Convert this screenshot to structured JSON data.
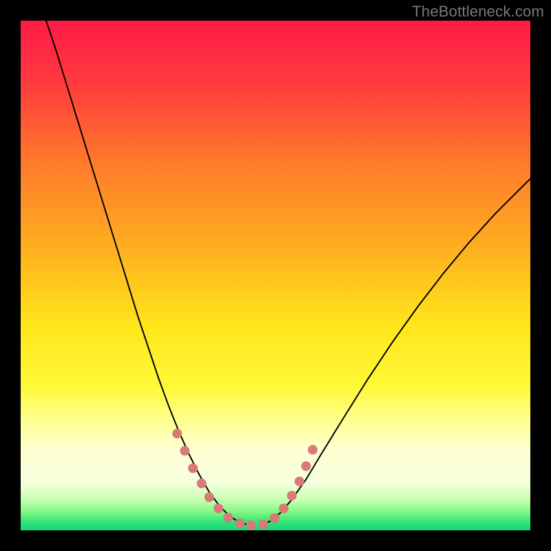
{
  "watermark": "TheBottleneck.com",
  "chart_data": {
    "type": "line",
    "title": "",
    "xlabel": "",
    "ylabel": "",
    "xlim": [
      0,
      1
    ],
    "ylim": [
      0,
      1
    ],
    "background_gradient": {
      "stops": [
        {
          "offset": 0.0,
          "color": "#ff1a45"
        },
        {
          "offset": 0.12,
          "color": "#ff3a3f"
        },
        {
          "offset": 0.28,
          "color": "#ff7a2a"
        },
        {
          "offset": 0.45,
          "color": "#ffb01f"
        },
        {
          "offset": 0.6,
          "color": "#ffe61a"
        },
        {
          "offset": 0.72,
          "color": "#fff93a"
        },
        {
          "offset": 0.78,
          "color": "#ffff8a"
        },
        {
          "offset": 0.84,
          "color": "#ffffd0"
        },
        {
          "offset": 0.905,
          "color": "#f6ffdf"
        },
        {
          "offset": 0.94,
          "color": "#c9ffb0"
        },
        {
          "offset": 0.965,
          "color": "#7cf783"
        },
        {
          "offset": 0.985,
          "color": "#2de37a"
        },
        {
          "offset": 1.0,
          "color": "#17d67a"
        }
      ]
    },
    "series": [
      {
        "name": "left-curve",
        "color": "#000000",
        "width": 2,
        "points": [
          {
            "x": 0.05,
            "y": 1.0
          },
          {
            "x": 0.07,
            "y": 0.94
          },
          {
            "x": 0.09,
            "y": 0.875
          },
          {
            "x": 0.11,
            "y": 0.81
          },
          {
            "x": 0.13,
            "y": 0.745
          },
          {
            "x": 0.15,
            "y": 0.68
          },
          {
            "x": 0.17,
            "y": 0.615
          },
          {
            "x": 0.19,
            "y": 0.55
          },
          {
            "x": 0.21,
            "y": 0.485
          },
          {
            "x": 0.23,
            "y": 0.42
          },
          {
            "x": 0.25,
            "y": 0.36
          },
          {
            "x": 0.27,
            "y": 0.3
          },
          {
            "x": 0.29,
            "y": 0.245
          },
          {
            "x": 0.31,
            "y": 0.195
          },
          {
            "x": 0.33,
            "y": 0.15
          },
          {
            "x": 0.35,
            "y": 0.11
          },
          {
            "x": 0.37,
            "y": 0.075
          },
          {
            "x": 0.39,
            "y": 0.048
          },
          {
            "x": 0.41,
            "y": 0.028
          },
          {
            "x": 0.43,
            "y": 0.015
          },
          {
            "x": 0.45,
            "y": 0.01
          }
        ]
      },
      {
        "name": "right-curve",
        "color": "#000000",
        "width": 2,
        "points": [
          {
            "x": 0.47,
            "y": 0.01
          },
          {
            "x": 0.49,
            "y": 0.018
          },
          {
            "x": 0.51,
            "y": 0.035
          },
          {
            "x": 0.53,
            "y": 0.058
          },
          {
            "x": 0.56,
            "y": 0.1
          },
          {
            "x": 0.59,
            "y": 0.15
          },
          {
            "x": 0.63,
            "y": 0.215
          },
          {
            "x": 0.68,
            "y": 0.295
          },
          {
            "x": 0.73,
            "y": 0.37
          },
          {
            "x": 0.78,
            "y": 0.44
          },
          {
            "x": 0.83,
            "y": 0.505
          },
          {
            "x": 0.88,
            "y": 0.565
          },
          {
            "x": 0.93,
            "y": 0.62
          },
          {
            "x": 0.98,
            "y": 0.67
          },
          {
            "x": 1.0,
            "y": 0.69
          }
        ]
      }
    ],
    "markers": {
      "name": "salmon-dots",
      "color": "#d97a78",
      "radius_frac": 0.0095,
      "points": [
        {
          "x": 0.307,
          "y": 0.19
        },
        {
          "x": 0.322,
          "y": 0.156
        },
        {
          "x": 0.338,
          "y": 0.122
        },
        {
          "x": 0.355,
          "y": 0.092
        },
        {
          "x": 0.37,
          "y": 0.065
        },
        {
          "x": 0.388,
          "y": 0.043
        },
        {
          "x": 0.407,
          "y": 0.025
        },
        {
          "x": 0.43,
          "y": 0.014
        },
        {
          "x": 0.452,
          "y": 0.01
        },
        {
          "x": 0.476,
          "y": 0.012
        },
        {
          "x": 0.498,
          "y": 0.024
        },
        {
          "x": 0.516,
          "y": 0.043
        },
        {
          "x": 0.532,
          "y": 0.068
        },
        {
          "x": 0.547,
          "y": 0.096
        },
        {
          "x": 0.56,
          "y": 0.126
        },
        {
          "x": 0.573,
          "y": 0.158
        }
      ]
    }
  }
}
